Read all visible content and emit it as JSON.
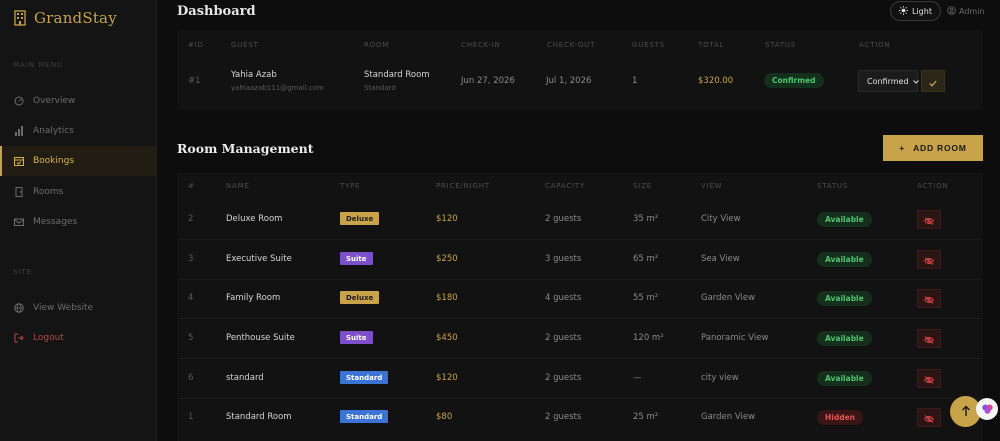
{
  "brand": {
    "name": "GrandStay"
  },
  "sidebar": {
    "main_section": "MAIN MENU",
    "items": [
      {
        "label": "Overview",
        "icon": "overview-icon"
      },
      {
        "label": "Analytics",
        "icon": "analytics-icon"
      },
      {
        "label": "Bookings",
        "icon": "bookings-icon",
        "active": true
      },
      {
        "label": "Rooms",
        "icon": "rooms-icon"
      },
      {
        "label": "Messages",
        "icon": "messages-icon"
      }
    ],
    "site_section": "SITE",
    "site_items": [
      {
        "label": "View Website",
        "icon": "globe-icon"
      },
      {
        "label": "Logout",
        "icon": "logout-icon"
      }
    ]
  },
  "header": {
    "title": "Dashboard",
    "theme_label": "Light",
    "user": "Admin"
  },
  "bookings": {
    "columns": [
      "#ID",
      "GUEST",
      "ROOM",
      "CHECK-IN",
      "CHECK-OUT",
      "GUESTS",
      "TOTAL",
      "STATUS",
      "ACTION"
    ],
    "rows": [
      {
        "id": "#1",
        "guest_name": "Yahia Azab",
        "guest_email": "yahiaazab111@gmail.com",
        "room": "Standard Room",
        "room_type": "Standard",
        "check_in": "Jun 27, 2026",
        "check_out": "Jul 1, 2026",
        "guests": "1",
        "total": "$320.00",
        "status": "Confirmed",
        "action_value": "Confirmed"
      }
    ]
  },
  "rooms": {
    "title": "Room Management",
    "add_label": "ADD ROOM",
    "columns": [
      "#",
      "NAME",
      "TYPE",
      "PRICE/NIGHT",
      "CAPACITY",
      "SIZE",
      "VIEW",
      "STATUS",
      "ACTION"
    ],
    "rows": [
      {
        "num": "2",
        "name": "Deluxe Room",
        "type": "Deluxe",
        "price": "$120",
        "capacity": "2 guests",
        "size": "35 m²",
        "view": "City View",
        "status": "Available"
      },
      {
        "num": "3",
        "name": "Executive Suite",
        "type": "Suite",
        "price": "$250",
        "capacity": "3 guests",
        "size": "65 m²",
        "view": "Sea View",
        "status": "Available"
      },
      {
        "num": "4",
        "name": "Family Room",
        "type": "Deluxe",
        "price": "$180",
        "capacity": "4 guests",
        "size": "55 m²",
        "view": "Garden View",
        "status": "Available"
      },
      {
        "num": "5",
        "name": "Penthouse Suite",
        "type": "Suite",
        "price": "$450",
        "capacity": "2 guests",
        "size": "120 m²",
        "view": "Panoramic View",
        "status": "Available"
      },
      {
        "num": "6",
        "name": "standard",
        "type": "Standard",
        "price": "$120",
        "capacity": "2 guests",
        "size": "—",
        "view": "city view",
        "status": "Available"
      },
      {
        "num": "1",
        "name": "Standard Room",
        "type": "Standard",
        "price": "$80",
        "capacity": "2 guests",
        "size": "25 m²",
        "view": "Garden View",
        "status": "Hidden"
      }
    ]
  },
  "colors": {
    "accent": "#c9a34a",
    "background": "#0d0d0d",
    "available": "#4fc26f",
    "hidden": "#e05555"
  }
}
